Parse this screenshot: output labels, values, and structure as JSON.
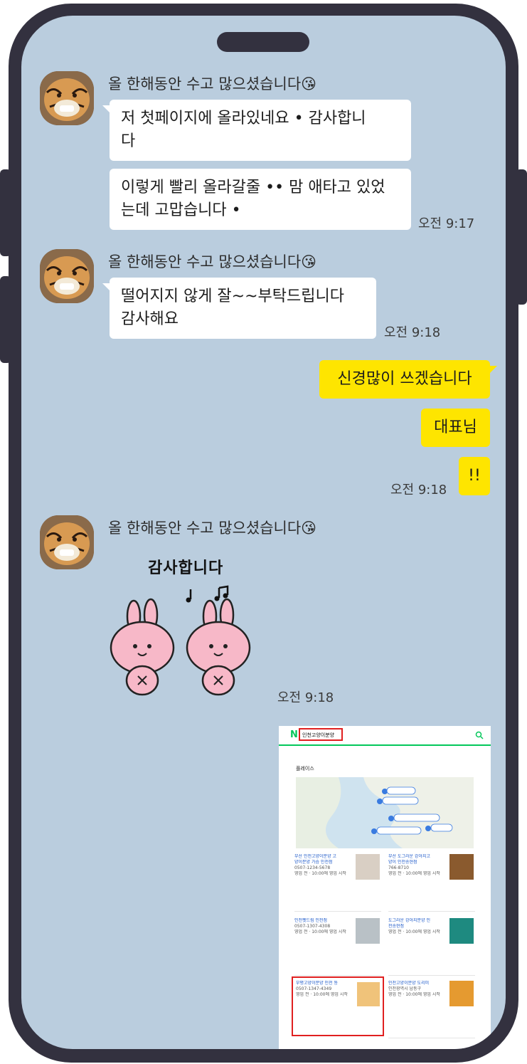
{
  "chat": {
    "sender_name": "올 한해동안 수고 많으셨습니다😘",
    "group1": {
      "msg1_line1": "저 첫페이지에 올라있네요 • 감사합니",
      "msg1_line2": "다",
      "msg2_line1": "이렇게 빨리 올라갈줄 •• 맘 애타고 있었",
      "msg2_line2": "는데 고맙습니다 •",
      "time": "오전 9:17"
    },
    "group2": {
      "msg1_line1": "떨어지지 않게 잘~~부탁드립니다",
      "msg1_line2": "감사해요",
      "time": "오전 9:18"
    },
    "mine": {
      "msg1": "신경많이 쓰겠습니다",
      "msg2": "대표님",
      "msg3": "!!",
      "time": "오전 9:18"
    },
    "group3": {
      "sticker_text": "감사합니다",
      "time": "오전 9:18"
    }
  },
  "screenshot": {
    "search_query": "인천고양이분양",
    "section_title": "플레이스",
    "colors": {
      "naver_green": "#03c75a",
      "highlight_red": "#e02020",
      "link_blue": "#1a57c9"
    }
  },
  "colors": {
    "chat_background": "#bacdde",
    "my_bubble": "#fee500",
    "their_bubble": "#ffffff",
    "phone_frame": "#33313f"
  },
  "icons": [
    "tiger-avatar-icon",
    "rabbit-sticker-icon",
    "music-note-icon",
    "search-icon"
  ]
}
